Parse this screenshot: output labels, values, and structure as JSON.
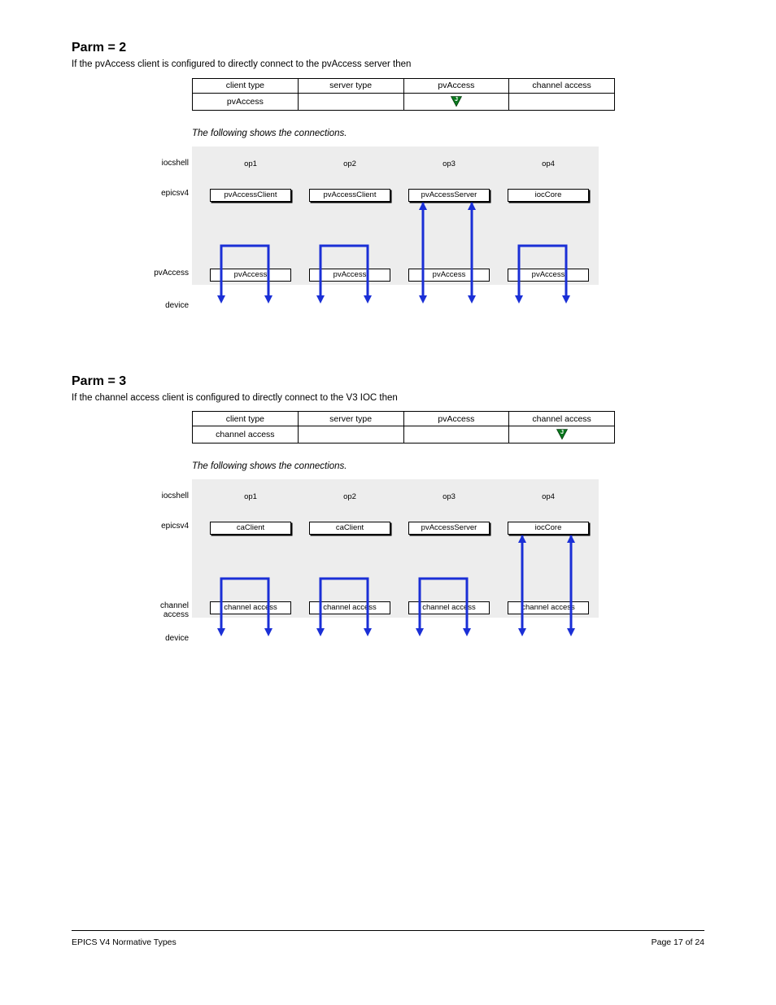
{
  "sections": [
    {
      "heading": "Parm = 2",
      "sub": "If the pvAccess client is configured to directly connect to the pvAccess server then",
      "headers": [
        "client type",
        "server type",
        "pvAccess",
        "channel access"
      ],
      "row": [
        "pvAccess",
        "",
        "marker",
        ""
      ],
      "caption": "The following shows the connections.",
      "rows": {
        "os_label": "iocshell",
        "ep_label": "epicsv4",
        "pv_label": "pvAccess",
        "dev_label": "device",
        "os_boxes": [
          "op1",
          "op2",
          "op3",
          "op4"
        ],
        "ep_boxes": [
          "pvAccessClient",
          "pvAccessClient",
          "pvAccessServer",
          "iocCore"
        ],
        "pv_boxes": [
          "pvAccess",
          "pvAccess",
          "pvAccess",
          "pvAccess"
        ]
      },
      "active_col": 2
    },
    {
      "heading": "Parm = 3",
      "sub": "If the channel access client is configured to directly connect to the V3 IOC then",
      "headers": [
        "client type",
        "server type",
        "pvAccess",
        "channel access"
      ],
      "row": [
        "channel access",
        "",
        "",
        "marker"
      ],
      "caption": "The following shows the connections.",
      "rows": {
        "os_label": "iocshell",
        "ep_label": "epicsv4",
        "pv_label": "channel access",
        "dev_label": "device",
        "os_boxes": [
          "op1",
          "op2",
          "op3",
          "op4"
        ],
        "ep_boxes": [
          "caClient",
          "caClient",
          "pvAccessServer",
          "iocCore"
        ],
        "pv_boxes": [
          "channel access",
          "channel access",
          "channel access",
          "channel access"
        ]
      },
      "active_col": 3
    }
  ],
  "footer": {
    "left": "EPICS V4 Normative Types",
    "right": "Page 17 of 24"
  }
}
